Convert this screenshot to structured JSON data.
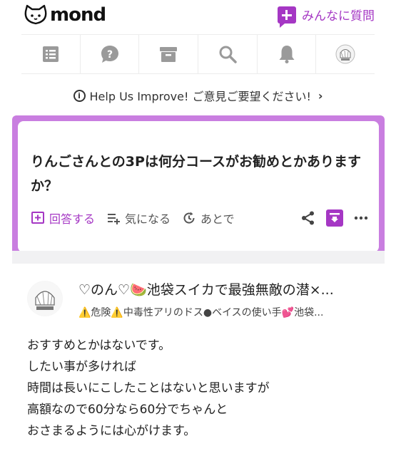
{
  "header": {
    "logo_text": "mond",
    "ask_label": "みんなに質問"
  },
  "nav": {
    "items": [
      {
        "icon": "list-icon"
      },
      {
        "icon": "question-bubble-icon"
      },
      {
        "icon": "archive-icon"
      },
      {
        "icon": "search-icon"
      },
      {
        "icon": "bell-icon"
      },
      {
        "icon": "user-avatar-icon"
      }
    ]
  },
  "help_bar": {
    "text": "Help Us Improve! ご意見ご要望ください!"
  },
  "question": {
    "text": "りんごさんとの3Pは何分コースがお勧めとかありますか？",
    "actions": {
      "answer": "回答する",
      "interest": "気になる",
      "later": "あとで"
    }
  },
  "answer": {
    "name": "♡のん♡🍉池袋スイカで最強無敵の潜×...",
    "bio": "⚠️危険⚠️中毒性アリのドス●ベイスの使い手💕池袋...",
    "lines": [
      "おすすめとかはないです。",
      "したい事が多ければ",
      "時間は長いにこしたことはないと思いますが",
      "高額なので60分なら60分でちゃんと",
      "おさまるようには心がけます。"
    ]
  },
  "colors": {
    "accent": "#a537c4",
    "card_border": "#c97ee0",
    "icon_gray": "#9a9a9a"
  }
}
